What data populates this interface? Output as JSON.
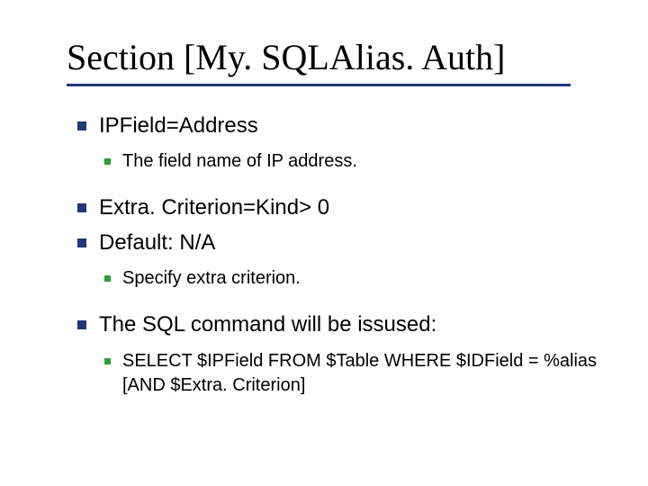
{
  "title": "Section [My. SQLAlias. Auth]",
  "items": [
    {
      "text": "IPField=Address",
      "sub": [
        {
          "text": "The field name of IP address."
        }
      ]
    },
    {
      "text": "Extra. Criterion=Kind> 0"
    },
    {
      "text": "Default: N/A",
      "sub": [
        {
          "text": "Specify extra criterion."
        }
      ]
    },
    {
      "text": "The SQL command will be issused:",
      "sub": [
        {
          "text": "SELECT $IPField FROM $Table WHERE $IDField = %alias [AND $Extra. Criterion]"
        }
      ]
    }
  ]
}
